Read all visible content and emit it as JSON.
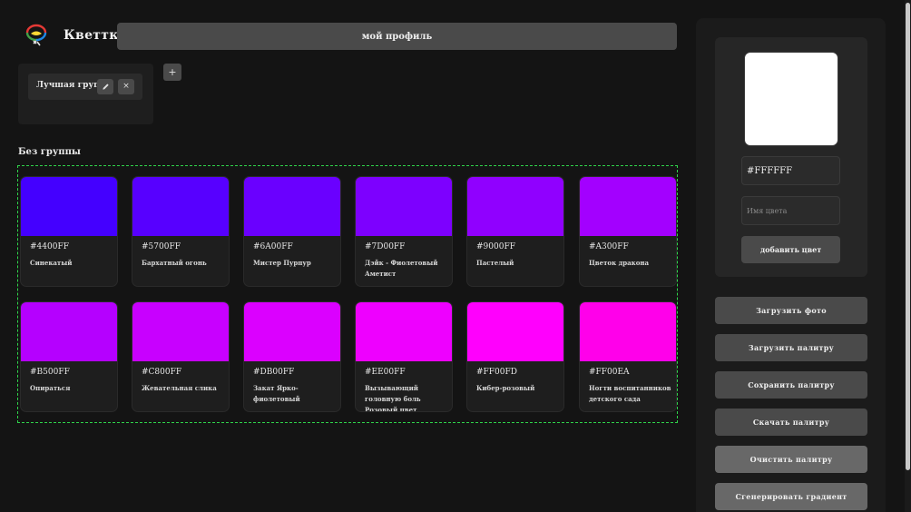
{
  "header": {
    "brand": "Кветтка",
    "profile_label": "мой профиль"
  },
  "groups": {
    "items": [
      {
        "label": "Лучшая группа",
        "edit_icon": "pencil-icon",
        "delete_label": "×"
      }
    ],
    "add_label": "+"
  },
  "ungrouped": {
    "title": "Без группы",
    "colors": [
      {
        "hex": "#4400FF",
        "name": "Синекатый"
      },
      {
        "hex": "#5700FF",
        "name": "Бархатный огонь"
      },
      {
        "hex": "#6A00FF",
        "name": "Мистер Пурпур"
      },
      {
        "hex": "#7D00FF",
        "name": "Дэйк - Фиолетовый Аметист"
      },
      {
        "hex": "#9000FF",
        "name": "Пастелый"
      },
      {
        "hex": "#A300FF",
        "name": "Цветок дракона"
      },
      {
        "hex": "#B500FF",
        "name": "Опираться"
      },
      {
        "hex": "#C800FF",
        "name": "Жевательная слика"
      },
      {
        "hex": "#DB00FF",
        "name": "Закат Ярко-фиолетовый"
      },
      {
        "hex": "#EE00FF",
        "name": "Вызывающий головную боль Розовый цвет"
      },
      {
        "hex": "#FF00FD",
        "name": "Кибер-розовый"
      },
      {
        "hex": "#FF00EA",
        "name": "Ногти воспитанников детского сада"
      }
    ]
  },
  "picker": {
    "preview_color": "#FFFFFF",
    "hex_value": "#FFFFFF",
    "name_placeholder": "Имя цвета",
    "add_label": "добавить цвет"
  },
  "actions": {
    "upload_photo": "Загрузить фото",
    "upload_palette": "Загрузить палитру",
    "save_palette": "Сохранить палитру",
    "download_palette": "Скачать палитру",
    "clear_palette": "Очистить палитру",
    "generate_gradient": "Сгенерировать градиент"
  }
}
